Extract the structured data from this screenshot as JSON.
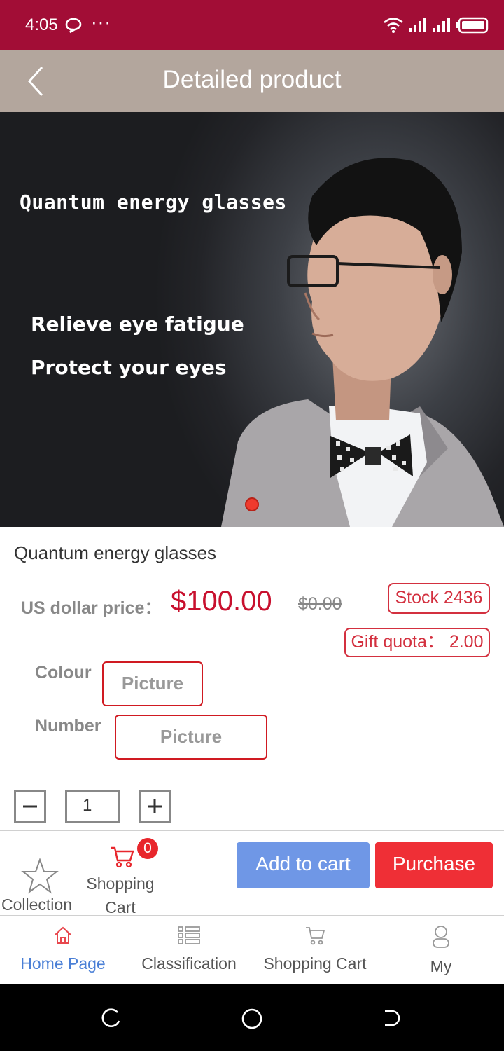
{
  "status_bar": {
    "time": "4:05",
    "dots": "···"
  },
  "header": {
    "title": "Detailed product"
  },
  "banner": {
    "headline": "Quantum energy glasses",
    "line1": "Relieve eye fatigue",
    "line2": "Protect your eyes"
  },
  "product": {
    "name": "Quantum energy glasses",
    "price_label": "US dollar price：",
    "price": "$100.00",
    "old_price": "$0.00",
    "stock": "Stock 2436",
    "gift_quota": "Gift quota：  2.00"
  },
  "options": {
    "colour_label": "Colour",
    "colour_value": "Picture",
    "number_label": "Number",
    "number_value": "Picture"
  },
  "quantity": {
    "value": "1"
  },
  "actions": {
    "collection": "Collection",
    "shopping_cart": "Shopping Cart",
    "cart_count": "0",
    "add_to_cart": "Add to cart",
    "purchase": "Purchase"
  },
  "tabs": [
    {
      "label": "Home Page",
      "icon": "home-icon",
      "active": true
    },
    {
      "label": "Classification",
      "icon": "list-icon",
      "active": false
    },
    {
      "label": "Shopping Cart",
      "icon": "cart-icon",
      "active": false
    },
    {
      "label": "My",
      "icon": "person-icon",
      "active": false
    }
  ],
  "colors": {
    "status_bar": "#a20d36",
    "header": "#b3a69d",
    "price": "#c8102e",
    "add_to_cart": "#6f97e6",
    "purchase": "#ef2f36",
    "tab_active": "#4a7fd6"
  }
}
